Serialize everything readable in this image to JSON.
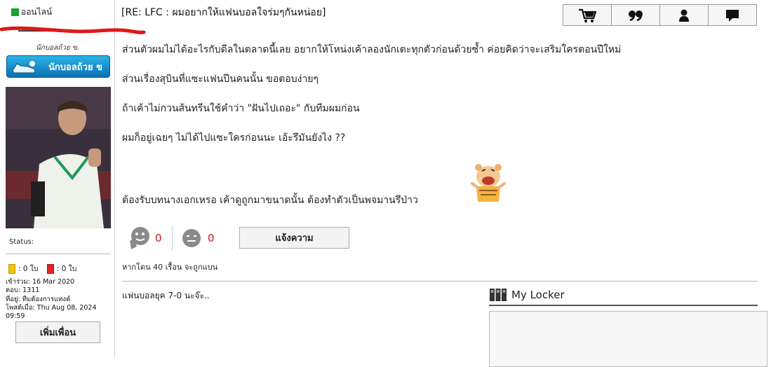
{
  "user": {
    "online_label": "ออนไลน์",
    "rank_caption": "นักบอลถ้วย ข.",
    "rank_badge_label": "นักบอลถ้วย ข",
    "status_label": "Status:",
    "yellow_cards": ": 0 ใบ",
    "red_cards": ": 0 ใบ",
    "joined": "เข้าร่วม: 16 Mar 2020",
    "replies": "ตอบ: 1311",
    "location": "ที่อยู่: ทีมต้องการแทงค์",
    "last_post": "โพสต์เมื่อ: Thu Aug 08, 2024 09:59",
    "add_friend_label": "เพิ่มเพื่อน"
  },
  "post": {
    "title": "[RE: LFC : ผมอยากให้แฟนบอลใจร่มๆกันหน่อย]",
    "lines": [
      "ส่วนตัวผมไม่ได้อะไรกับดีลในตลาดนี้เลย อยากให้โหน่งเค้าลองนักเตะทุกตัวก่อนด้วยซ้ำ ค่อยคิดว่าจะเสริมใครตอนปีใหม่",
      "ส่วนเรื่องสุบินที่แซะแฟนปีนคนนั้น ขอตอบง่ายๆ",
      "ถ้าเค้าไม่กวนส้นทรีนใช้คำว่า \"ฝันไปเถอะ\" กับทีมผมก่อน",
      "ผมก็อยู่เฉยๆ ไม่ได้ไปแซะใครก่อนนะ เอ้ะรึมันยังไง ??",
      "ต้องรับบทนางเอกเหรอ เค้าดูถูกมาขนาดนั้น ต้องทำตัวเป็นพจมานรึป่าว"
    ],
    "likes": "0",
    "dislikes": "0",
    "report_label": "แจ้งความ",
    "footnote": "หากโดน 40 เรื้อน จะถูกแบน",
    "signature": "แฟนบอลยุค 7-0 นะจ๊ะ.."
  },
  "toolbar": {
    "icons": [
      "cart-icon",
      "quote-icon",
      "user-icon",
      "message-icon"
    ]
  },
  "locker": {
    "title": "My Locker"
  },
  "colors": {
    "online": "#1aa12a",
    "reaction_count": "#d01616",
    "badge": "#0b6fb5"
  }
}
